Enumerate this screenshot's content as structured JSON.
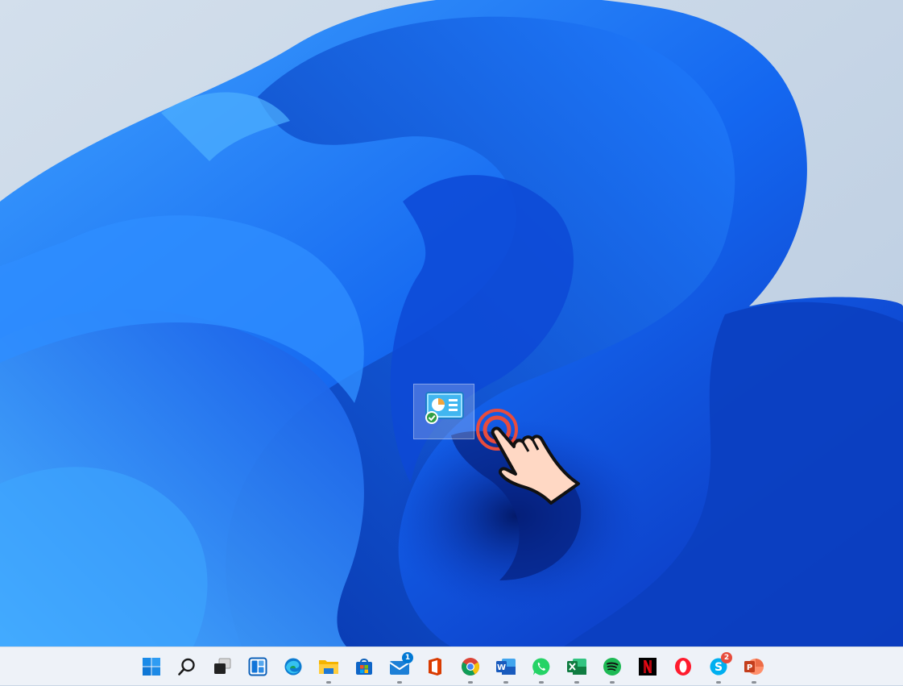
{
  "desktop": {
    "wallpaper": "windows-11-bloom",
    "icons": [
      {
        "name": "control-panel-shortcut",
        "icon": "system-settings-icon",
        "selected": true
      }
    ]
  },
  "pointer": {
    "icon": "hand-tap-icon",
    "accent": "#e84c3d"
  },
  "taskbar": {
    "apps": [
      {
        "id": "start",
        "icon": "windows-logo-icon",
        "running": false
      },
      {
        "id": "search",
        "icon": "search-icon",
        "running": false
      },
      {
        "id": "task-view",
        "icon": "task-view-icon",
        "running": false
      },
      {
        "id": "widgets",
        "icon": "widgets-icon",
        "running": false
      },
      {
        "id": "edge",
        "icon": "edge-icon",
        "running": false
      },
      {
        "id": "file-explorer",
        "icon": "folder-icon",
        "running": true
      },
      {
        "id": "store",
        "icon": "store-icon",
        "running": false
      },
      {
        "id": "mail",
        "icon": "mail-icon",
        "running": true,
        "badge": "1"
      },
      {
        "id": "office",
        "icon": "office-icon",
        "running": false
      },
      {
        "id": "chrome",
        "icon": "chrome-icon",
        "running": true
      },
      {
        "id": "word",
        "icon": "word-icon",
        "running": true
      },
      {
        "id": "whatsapp",
        "icon": "whatsapp-icon",
        "running": true
      },
      {
        "id": "excel",
        "icon": "excel-icon",
        "running": true
      },
      {
        "id": "spotify",
        "icon": "spotify-icon",
        "running": true
      },
      {
        "id": "netflix",
        "icon": "netflix-icon",
        "running": false
      },
      {
        "id": "opera",
        "icon": "opera-icon",
        "running": false
      },
      {
        "id": "skype",
        "icon": "skype-icon",
        "running": true,
        "badge": "2"
      },
      {
        "id": "powerpoint",
        "icon": "powerpoint-icon",
        "running": true
      }
    ],
    "colors": {
      "background": "#eef2f8",
      "accent": "#0078d4",
      "badge_mail": "#0078d4",
      "badge_skype": "#e74c3c"
    }
  }
}
